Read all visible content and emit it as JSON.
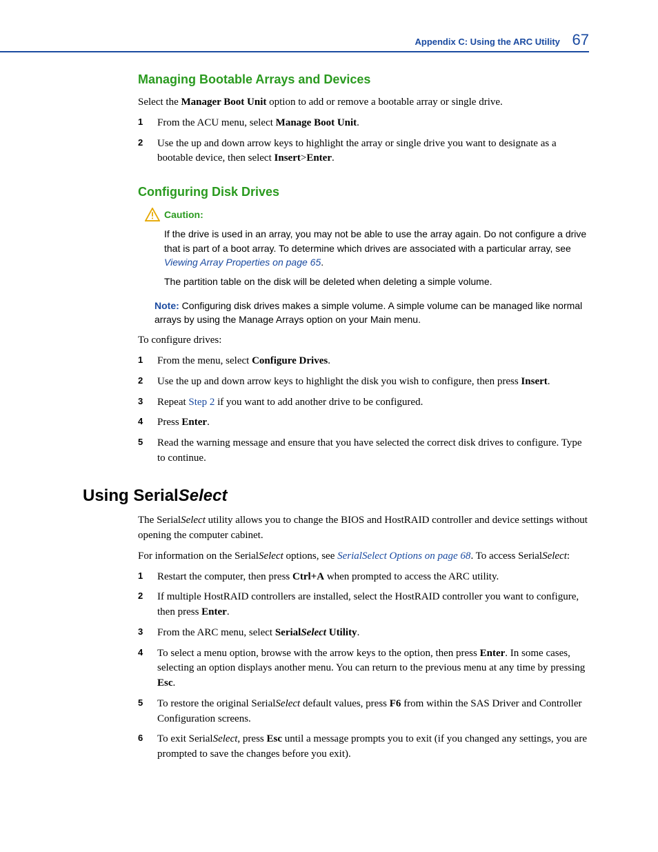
{
  "header": {
    "title": "Appendix C: Using the ARC Utility",
    "page_num": "67"
  },
  "sec1": {
    "heading": "Managing Bootable Arrays and Devices",
    "intro_a": "Select the ",
    "intro_bold": "Manager Boot Unit",
    "intro_b": " option to add or remove a bootable array or single drive.",
    "steps": [
      {
        "n": "1",
        "a": "From the ACU menu, select ",
        "bold": "Manage Boot Unit",
        "b": "."
      },
      {
        "n": "2",
        "a": "Use the up and down arrow keys to highlight the array or single drive you want to designate as a bootable device, then select ",
        "bold": "Insert",
        "mid": ">",
        "bold2": "Enter",
        "b": "."
      }
    ]
  },
  "sec2": {
    "heading": "Configuring Disk Drives",
    "caution_label": "Caution:",
    "caution_p1_a": "If the drive is used in an array, you may not be able to use the array again. Do not configure a drive that is part of a boot array. To determine which drives are associated with a particular array, see ",
    "caution_link": "Viewing Array Properties",
    "caution_link_suffix": " on page 65",
    "caution_p1_b": ".",
    "caution_p2": "The partition table on the disk will be deleted when deleting a simple volume.",
    "note_label": "Note:",
    "note_text": " Configuring disk drives makes a simple volume. A simple volume can be managed like normal arrays by using the Manage Arrays option on your Main menu.",
    "intro": "To configure drives:",
    "steps": [
      {
        "n": "1",
        "a": "From the menu, select ",
        "bold": "Configure Drives",
        "b": "."
      },
      {
        "n": "2",
        "a": "Use the up and down arrow keys to highlight the disk you wish to configure, then press ",
        "bold": "Insert",
        "b": "."
      },
      {
        "n": "3",
        "a": "Repeat ",
        "link": "Step 2",
        "b": " if you want to add another drive to be configured."
      },
      {
        "n": "4",
        "a": "Press ",
        "bold": "Enter",
        "b": "."
      },
      {
        "n": "5",
        "a": "Read the warning message and ensure that you have selected the correct disk drives to configure. Type   to continue."
      }
    ]
  },
  "sec3": {
    "heading_a": "Using Serial",
    "heading_ital": "Select",
    "intro_a": "The Serial",
    "intro_ital": "Select",
    "intro_b": " utility allows you to change the BIOS and HostRAID controller and device settings without opening the computer cabinet.",
    "info_a": "For information on the Serial",
    "info_ital": "Select",
    "info_b": " options, see ",
    "info_link": "SerialSelect Options",
    "info_link_suffix": " on page 68",
    "info_c": ". To access Serial",
    "info_ital2": "Select",
    "info_d": ":",
    "steps": [
      {
        "n": "1",
        "a": "Restart the computer, then press ",
        "bold": "Ctrl+A",
        "b": " when prompted to access the ARC utility."
      },
      {
        "n": "2",
        "a": "If multiple HostRAID controllers are installed, select the HostRAID controller you want to configure, then press ",
        "bold": "Enter",
        "b": "."
      },
      {
        "n": "3",
        "a": "From the ARC menu, select ",
        "bold_a": "Serial",
        "bold_ital": "Select",
        "bold_b": " Utility",
        "b": "."
      },
      {
        "n": "4",
        "a": "To select a menu option, browse with the arrow keys to the option, then press ",
        "bold": "Enter",
        "b": ". In some cases, selecting an option displays another menu. You can return to the previous menu at any time by pressing ",
        "bold2": "Esc",
        "c": "."
      },
      {
        "n": "5",
        "a": "To restore the original Serial",
        "ital": "Select",
        "b": " default values, press ",
        "bold": "F6",
        "c": " from within the SAS Driver and Controller Configuration screens."
      },
      {
        "n": "6",
        "a": "To exit Serial",
        "ital": "Select",
        "b": ", press ",
        "bold": "Esc",
        "c": " until a message prompts you to exit (if you changed any settings, you are prompted to save the changes before you exit)."
      }
    ]
  }
}
